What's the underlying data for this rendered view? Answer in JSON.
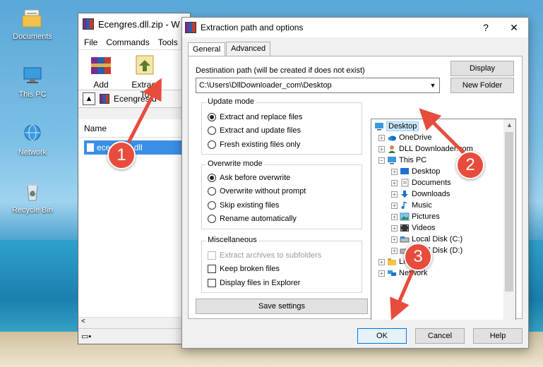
{
  "desktop": {
    "icons": [
      {
        "label": "Documents",
        "icon": "folder-icon"
      },
      {
        "label": "This PC",
        "icon": "computer-icon"
      },
      {
        "label": "Network",
        "icon": "network-icon"
      },
      {
        "label": "Recycle Bin",
        "icon": "recycle-bin-icon"
      }
    ]
  },
  "winrar": {
    "title": "Ecengres.dll.zip - W",
    "menu": [
      "File",
      "Commands",
      "Tools"
    ],
    "tools": [
      {
        "label": "Add",
        "icon": "add-archive-icon"
      },
      {
        "label": "Extract To",
        "icon": "extract-to-icon"
      }
    ],
    "path_text": "Ecengres.d",
    "column_name": "Name",
    "file": "ecengres.dll"
  },
  "dialog": {
    "title": "Extraction path and options",
    "help": "?",
    "close": "✕",
    "tabs": [
      "General",
      "Advanced"
    ],
    "dest_label": "Destination path (will be created if does not exist)",
    "dest_value": "C:\\Users\\DllDownloader_com\\Desktop",
    "display_button": "Display",
    "new_folder_button": "New Folder",
    "update_mode": {
      "title": "Update mode",
      "options": [
        "Extract and replace files",
        "Extract and update files",
        "Fresh existing files only"
      ],
      "selected": 0
    },
    "overwrite_mode": {
      "title": "Overwrite mode",
      "options": [
        "Ask before overwrite",
        "Overwrite without prompt",
        "Skip existing files",
        "Rename automatically"
      ],
      "selected": 0
    },
    "misc": {
      "title": "Miscellaneous",
      "options": [
        "Extract archives to subfolders",
        "Keep broken files",
        "Display files in Explorer"
      ]
    },
    "save_settings": "Save settings",
    "tree": [
      {
        "label": "Desktop",
        "icon": "desktop-icon"
      },
      {
        "label": "OneDrive",
        "icon": "onedrive-icon"
      },
      {
        "label": "DLL Downloader.com",
        "icon": "user-icon"
      },
      {
        "label": "This PC",
        "icon": "computer-icon"
      },
      {
        "label": "Desktop",
        "icon": "desktop-icon"
      },
      {
        "label": "Documents",
        "icon": "documents-icon"
      },
      {
        "label": "Downloads",
        "icon": "downloads-icon"
      },
      {
        "label": "Music",
        "icon": "music-icon"
      },
      {
        "label": "Pictures",
        "icon": "pictures-icon"
      },
      {
        "label": "Videos",
        "icon": "videos-icon"
      },
      {
        "label": "Local Disk (C:)",
        "icon": "drive-icon"
      },
      {
        "label": "Local Disk (D:)",
        "icon": "drive-icon"
      },
      {
        "label": "Libraries",
        "icon": "libraries-icon"
      },
      {
        "label": "Network",
        "icon": "network-icon"
      }
    ],
    "ok": "OK",
    "cancel": "Cancel",
    "help_button": "Help"
  },
  "annotations": [
    "1",
    "2",
    "3"
  ],
  "colors": {
    "marker": "#e74c3c",
    "selection": "#3b8fe6"
  }
}
